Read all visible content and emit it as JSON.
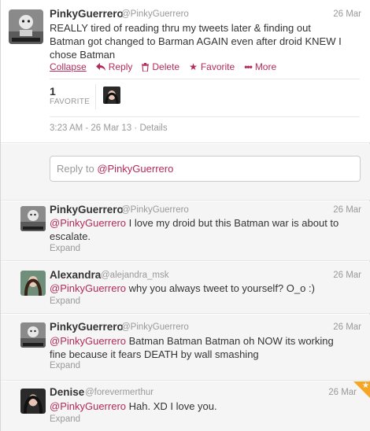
{
  "main_tweet": {
    "name": "PinkyGuerrero",
    "handle": "@PinkyGuerrero",
    "date": "26 Mar",
    "text_lines": [
      "REALLY tired of reading thru my tweets later & finding out",
      "Batman got changed to Barman AGAIN even after droid KNEW I",
      "chose Batman"
    ],
    "actions": {
      "collapse": "Collapse",
      "reply": "Reply",
      "delete": "Delete",
      "favorite": "Favorite",
      "more": "More"
    },
    "favorites_count": "1",
    "favorites_label": "FAVORITE",
    "timestamp": "3:23 AM - 26 Mar 13",
    "details": "Details"
  },
  "reply_box": {
    "prefix": "Reply to ",
    "mention": "@PinkyGuerrero"
  },
  "replies": [
    {
      "name": "PinkyGuerrero",
      "handle": "@PinkyGuerrero",
      "date": "26 Mar",
      "mention": "@PinkyGuerrero",
      "text": " I love my droid but this Batman war is about to",
      "text_line2": "escalate.",
      "expand": "Expand"
    },
    {
      "name": "Alexandra",
      "handle": "@alejandra_msk",
      "date": "26 Mar",
      "mention": "@PinkyGuerrero",
      "text": " why you always tweet to yourself? O_o :)",
      "expand": "Expand"
    },
    {
      "name": "PinkyGuerrero",
      "handle": "@PinkyGuerrero",
      "date": "26 Mar",
      "mention": "@PinkyGuerrero",
      "text": " Batman Batman Batman oh NOW its working",
      "text_line2": "fine because it fears DEATH by wall smashing",
      "expand": "Expand"
    },
    {
      "name": "Denise",
      "handle": "@forevermerthur",
      "date": "26 Mar",
      "mention": "@PinkyGuerrero",
      "text": " Hah. XD I love you.",
      "expand": "Expand"
    }
  ],
  "colors": {
    "link": "#b32a5b",
    "muted": "#999999",
    "text": "#333333",
    "reply_bg": "#f5f5f5",
    "favorite_ribbon": "#f6a623"
  }
}
